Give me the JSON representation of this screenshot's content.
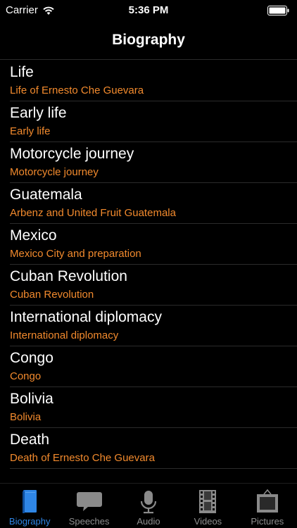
{
  "status_bar": {
    "carrier": "Carrier",
    "time": "5:36 PM"
  },
  "nav": {
    "title": "Biography"
  },
  "colors": {
    "subtitle": "#f28a2d",
    "tab_selected": "#2f86e6",
    "tab_unselected": "#8e8e8e"
  },
  "list": {
    "items": [
      {
        "title": "Life",
        "subtitle": "Life of Ernesto Che Guevara"
      },
      {
        "title": "Early life",
        "subtitle": "Early life"
      },
      {
        "title": "Motorcycle journey",
        "subtitle": "Motorcycle journey"
      },
      {
        "title": "Guatemala",
        "subtitle": "Arbenz and United Fruit Guatemala"
      },
      {
        "title": "Mexico",
        "subtitle": "Mexico City and preparation"
      },
      {
        "title": "Cuban Revolution",
        "subtitle": "Cuban Revolution"
      },
      {
        "title": "International diplomacy",
        "subtitle": "International diplomacy"
      },
      {
        "title": "Congo",
        "subtitle": "Congo"
      },
      {
        "title": "Bolivia",
        "subtitle": "Bolivia"
      },
      {
        "title": "Death",
        "subtitle": "Death of Ernesto Che Guevara"
      }
    ]
  },
  "tabs": [
    {
      "label": "Biography",
      "icon": "book-icon",
      "selected": true
    },
    {
      "label": "Speeches",
      "icon": "speech-bubble-icon",
      "selected": false
    },
    {
      "label": "Audio",
      "icon": "microphone-icon",
      "selected": false
    },
    {
      "label": "Videos",
      "icon": "film-strip-icon",
      "selected": false
    },
    {
      "label": "Pictures",
      "icon": "picture-frame-icon",
      "selected": false
    }
  ]
}
